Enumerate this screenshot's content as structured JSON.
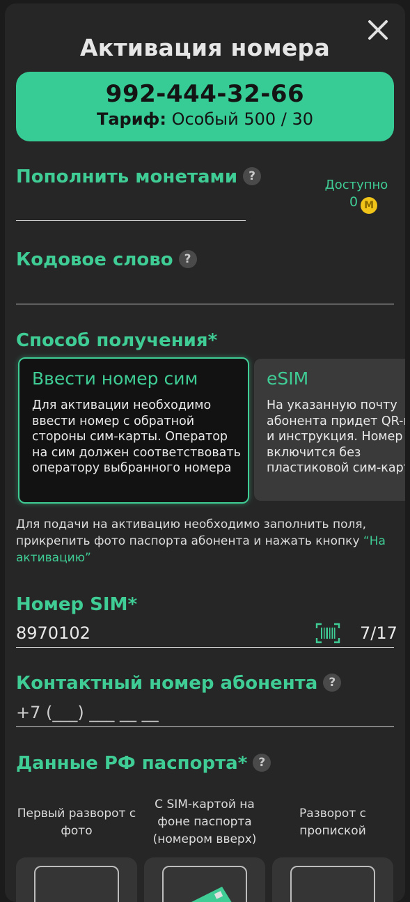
{
  "dialog": {
    "title": "Активация номера",
    "close_icon": "close-icon"
  },
  "number_card": {
    "phone": "992-444-32-66",
    "tariff_label": "Тариф:",
    "tariff_value": " Особый 500 / 30"
  },
  "coins": {
    "label": "Пополнить монетами",
    "help": "?",
    "input_value": "",
    "available_label": "Доступно",
    "available_value": "0",
    "coin_symbol": "M"
  },
  "code_word": {
    "label": "Кодовое слово",
    "help": "?",
    "input_value": ""
  },
  "delivery": {
    "label": "Способ получения*",
    "options": [
      {
        "title": "Ввести номер сим",
        "description": "Для активации необходимо ввести номер с обратной стороны сим-карты. Оператор на сим должен соответствовать оператору выбранного номера",
        "selected": true
      },
      {
        "title": "eSIM",
        "description": "На указанную почту абонента придет QR-код и инструкция. Номер включится без пластиковой сим-карты",
        "selected": false
      }
    ]
  },
  "info": {
    "text": "Для подачи на активацию необходимо заполнить поля, прикрепить фото паспорта абонента и нажать кнопку ",
    "link": "“На активацию”"
  },
  "sim_number": {
    "label": "Номер SIM*",
    "value": "8970102",
    "counter": "7/17",
    "scan_icon": "barcode-scan-icon"
  },
  "contact_phone": {
    "label": "Контактный номер абонента",
    "help": "?",
    "placeholder": "+7 (___) ___ __ __"
  },
  "passport": {
    "label": "Данные РФ паспорта*",
    "help": "?",
    "photos": [
      {
        "label": "Первый разворот с фото"
      },
      {
        "label": "С SIM-картой на фоне паспорта (номером вверх)"
      },
      {
        "label": "Разворот с пропиской"
      }
    ]
  },
  "colors": {
    "accent": "#3fcc95",
    "card_green": "#37cc96",
    "background": "#262626",
    "coin": "#f0c419"
  }
}
